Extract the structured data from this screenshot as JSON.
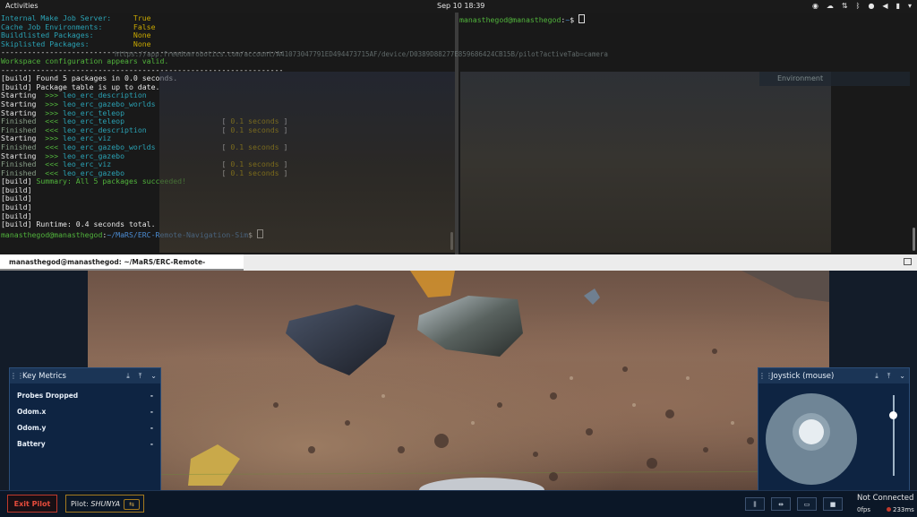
{
  "topbar": {
    "activities": "Activities",
    "clock": "Sep 10  18:39"
  },
  "browser": {
    "url": "https://app.freedomrobotics.com/account/A41073047791ED494473715AF/device/D0389D88277E859686424CB15B/pilot?activeTab=camera",
    "environment_panel": "Environment"
  },
  "terminal_left": {
    "lines": [
      [
        [
          "Internal Make Job Server:     ",
          "c-cyan"
        ],
        [
          "True",
          "c-yellow"
        ]
      ],
      [
        [
          "Cache Job Environments:       ",
          "c-cyan"
        ],
        [
          "False",
          "c-yellow"
        ]
      ],
      [
        [
          "",
          "c-white"
        ]
      ],
      [
        [
          "Buildlisted Packages:         ",
          "c-cyan"
        ],
        [
          "None",
          "c-yellow"
        ]
      ],
      [
        [
          "Skiplisted Packages:          ",
          "c-cyan"
        ],
        [
          "None",
          "c-yellow"
        ]
      ],
      [
        [
          "----------------------------------------------------------------",
          "c-white"
        ]
      ],
      [
        [
          "Workspace configuration appears valid.",
          "c-green"
        ]
      ],
      [
        [
          "----------------------------------------------------------------",
          "c-white"
        ]
      ],
      [
        [
          "[build] Found 5 packages in 0.0 seconds.",
          "c-white"
        ]
      ],
      [
        [
          "[build] Package table is up to date.",
          "c-white"
        ]
      ],
      [
        [
          "Starting  ",
          "c-white"
        ],
        [
          ">>> ",
          "c-green"
        ],
        [
          "leo_erc_description",
          "c-cyan"
        ]
      ],
      [
        [
          "Starting  ",
          "c-white"
        ],
        [
          ">>> ",
          "c-green"
        ],
        [
          "leo_erc_gazebo_worlds",
          "c-cyan"
        ]
      ],
      [
        [
          "Starting  ",
          "c-white"
        ],
        [
          ">>> ",
          "c-green"
        ],
        [
          "leo_erc_teleop",
          "c-cyan"
        ]
      ],
      [
        [
          "Finished  ",
          "c-dim"
        ],
        [
          "<<< ",
          "c-green"
        ],
        [
          "leo_erc_teleop",
          "c-cyan"
        ],
        [
          "                      [ ",
          "c-white"
        ],
        [
          "0.1 seconds",
          "c-yellow"
        ],
        [
          " ]",
          "c-white"
        ]
      ],
      [
        [
          "Finished  ",
          "c-dim"
        ],
        [
          "<<< ",
          "c-green"
        ],
        [
          "leo_erc_description",
          "c-cyan"
        ],
        [
          "                 [ ",
          "c-white"
        ],
        [
          "0.1 seconds",
          "c-yellow"
        ],
        [
          " ]",
          "c-white"
        ]
      ],
      [
        [
          "Starting  ",
          "c-white"
        ],
        [
          ">>> ",
          "c-green"
        ],
        [
          "leo_erc_viz",
          "c-cyan"
        ]
      ],
      [
        [
          "Finished  ",
          "c-dim"
        ],
        [
          "<<< ",
          "c-green"
        ],
        [
          "leo_erc_gazebo_worlds",
          "c-cyan"
        ],
        [
          "               [ ",
          "c-white"
        ],
        [
          "0.1 seconds",
          "c-yellow"
        ],
        [
          " ]",
          "c-white"
        ]
      ],
      [
        [
          "Starting  ",
          "c-white"
        ],
        [
          ">>> ",
          "c-green"
        ],
        [
          "leo_erc_gazebo",
          "c-cyan"
        ]
      ],
      [
        [
          "Finished  ",
          "c-dim"
        ],
        [
          "<<< ",
          "c-green"
        ],
        [
          "leo_erc_viz",
          "c-cyan"
        ],
        [
          "                         [ ",
          "c-white"
        ],
        [
          "0.1 seconds",
          "c-yellow"
        ],
        [
          " ]",
          "c-white"
        ]
      ],
      [
        [
          "Finished  ",
          "c-dim"
        ],
        [
          "<<< ",
          "c-green"
        ],
        [
          "leo_erc_gazebo",
          "c-cyan"
        ],
        [
          "                      [ ",
          "c-white"
        ],
        [
          "0.1 seconds",
          "c-yellow"
        ],
        [
          " ]",
          "c-white"
        ]
      ],
      [
        [
          "[build] ",
          "c-white"
        ],
        [
          "Summary: All 5 packages succeeded!",
          "c-green"
        ]
      ],
      [
        [
          "[build]",
          "c-white"
        ]
      ],
      [
        [
          "[build]",
          "c-white"
        ]
      ],
      [
        [
          "[build]",
          "c-white"
        ]
      ],
      [
        [
          "[build]",
          "c-white"
        ]
      ],
      [
        [
          "[build] ",
          "c-white"
        ],
        [
          "Runtime: 0.4 seconds total.",
          "c-white"
        ]
      ],
      [
        [
          "manasthegod@manasthegod",
          "c-green"
        ],
        [
          ":",
          "c-white"
        ],
        [
          "~/MaRS/ERC-Remote-Navigation-Sim",
          "c-blue"
        ],
        [
          "$ ",
          "c-white"
        ]
      ]
    ]
  },
  "terminal_right": {
    "user": "manasthegod@manasthegod",
    "sep": ":",
    "path": "~",
    "prompt": "$ "
  },
  "terminal_title": "manasthegod@manasthegod: ~/MaRS/ERC-Remote-Navigation-Sim",
  "key_metrics": {
    "title": "Key Metrics",
    "rows": [
      {
        "label": "Probes Dropped",
        "value": "-"
      },
      {
        "label": "Odom.x",
        "value": "-"
      },
      {
        "label": "Odom.y",
        "value": "-"
      },
      {
        "label": "Battery",
        "value": "-"
      }
    ]
  },
  "joystick": {
    "title": "Joystick (mouse)"
  },
  "bottombar": {
    "exit_pilot": "Exit Pilot",
    "pilot_label": "Pilot: ",
    "pilot_name": "SHUNYA",
    "connection": "Not Connected",
    "fps": "0fps",
    "latency": "233ms"
  },
  "colors": {
    "panel_bg": "#0e2442",
    "panel_header": "#1b3556",
    "exit_red": "#e74c3c",
    "pilot_gold": "#a57a1e"
  }
}
